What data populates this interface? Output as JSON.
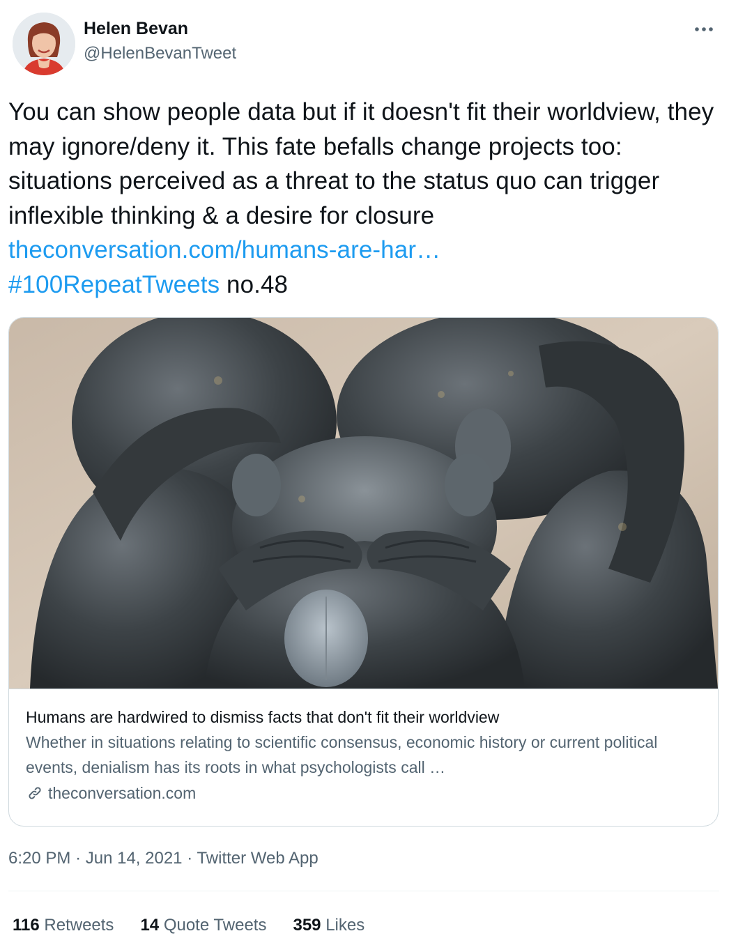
{
  "author": {
    "display_name": "Helen Bevan",
    "handle": "@HelenBevanTweet"
  },
  "tweet": {
    "text": "You can show people data but if it doesn't fit their worldview, they may ignore/deny it. This fate befalls change projects too: situations perceived as a threat to the status quo can trigger inflexible thinking & a desire for closure",
    "link_text": "theconversation.com/humans-are-har…",
    "hashtag": "#100RepeatTweets",
    "suffix": "no.48"
  },
  "card": {
    "title": "Humans are hardwired to dismiss facts that don't fit their worldview",
    "description": "Whether in situations relating to scientific consensus, economic history or current political events, denialism has its roots in what psychologists call …",
    "domain": "theconversation.com",
    "domain_icon": "link-icon"
  },
  "meta": {
    "time": "6:20 PM",
    "separator": "·",
    "date": "Jun 14, 2021",
    "source": "Twitter Web App"
  },
  "stats": {
    "retweets": {
      "count": "116",
      "label": "Retweets"
    },
    "quotes": {
      "count": "14",
      "label": "Quote Tweets"
    },
    "likes": {
      "count": "359",
      "label": "Likes"
    }
  },
  "colors": {
    "link": "#1d9bf0",
    "secondary_text": "#536471",
    "border": "#cfd9de"
  },
  "icons": {
    "more": "more-dots-icon",
    "card_link": "link-icon"
  }
}
